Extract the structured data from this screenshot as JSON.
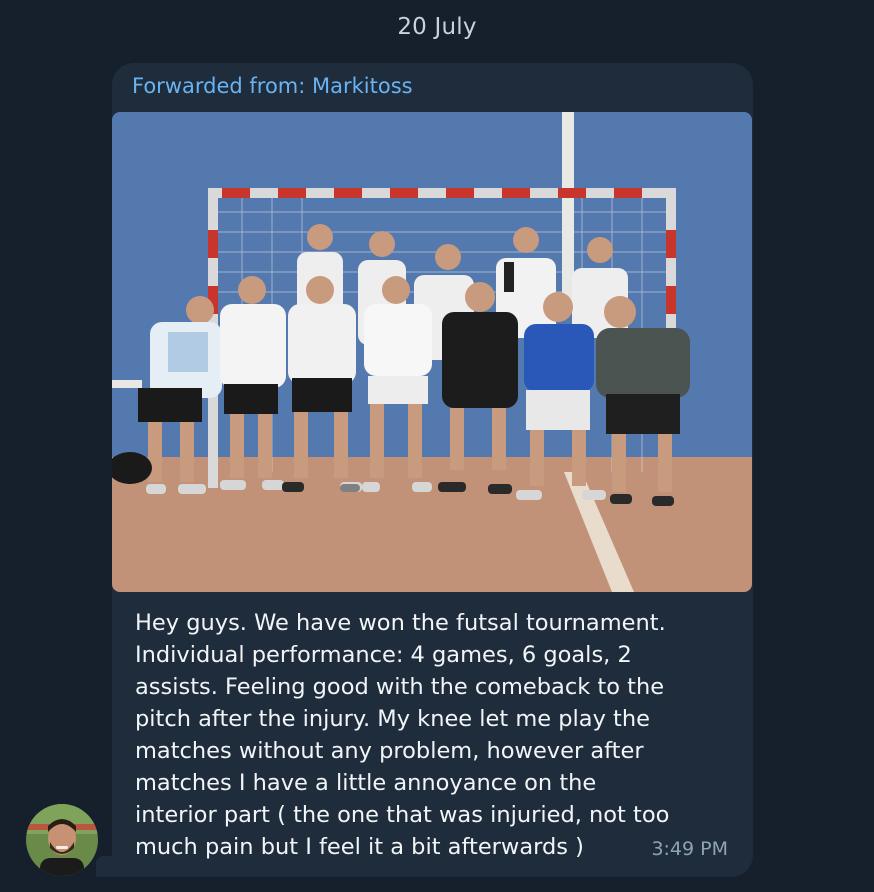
{
  "date_separator": "20 July",
  "message": {
    "forwarded_from": "Forwarded from: Markitoss",
    "photo_description": "team-photo",
    "text": "Hey guys. We have won the futsal tournament.\nIndividual performance: 4 games, 6 goals, 2\nassists. Feeling good with the comeback to the\npitch after the injury. My knee let me play the\nmatches without any problem, however after\nmatches I have a little annoyance on the\ninterior part ( the one that was injuried, not too\nmuch pain but I feel it a bit afterwards )",
    "time": "3:49 PM"
  },
  "colors": {
    "background": "#16202c",
    "bubble": "#1e2c3c",
    "accent_link": "#6ab3f3",
    "text": "#f2f5f8",
    "time": "#8fa3b6"
  },
  "icons": {
    "avatar": "sender-avatar"
  }
}
